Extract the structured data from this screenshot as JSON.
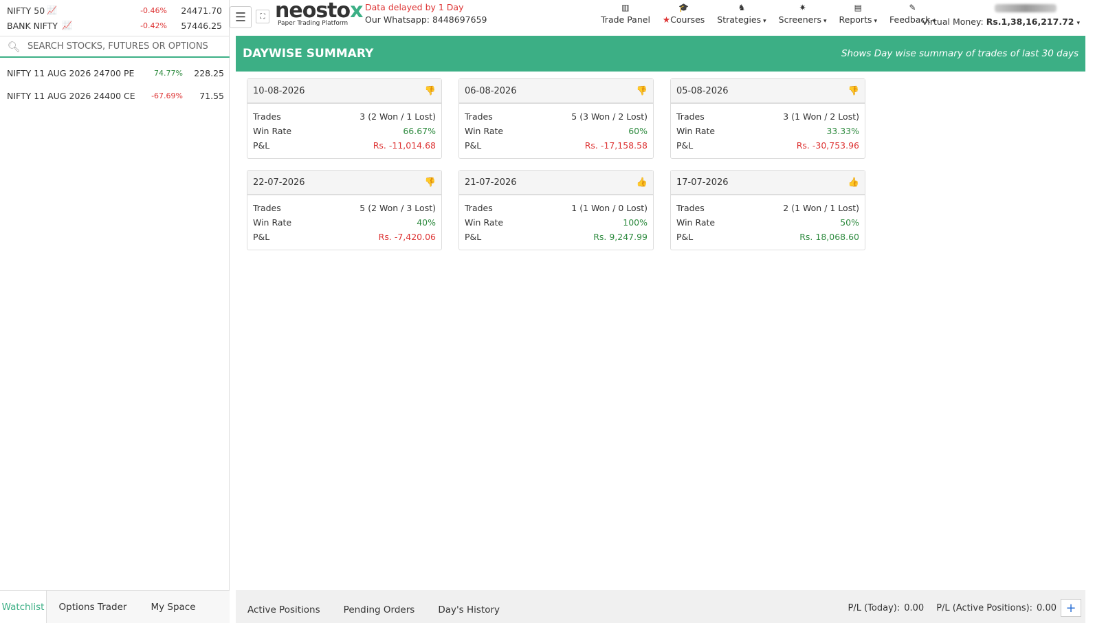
{
  "indices": [
    {
      "name": "NIFTY 50",
      "change": "-0.46%",
      "value": "24471.70"
    },
    {
      "name": "BANK NIFTY",
      "change": "-0.42%",
      "value": "57446.25"
    }
  ],
  "search": {
    "placeholder": "SEARCH STOCKS, FUTURES OR OPTIONS"
  },
  "watchlist": [
    {
      "name": "NIFTY 11 AUG 2026 24700 PE",
      "change": "74.77%",
      "value": "228.25"
    },
    {
      "name": "NIFTY 11 AUG 2026 24400 CE",
      "change": "-67.69%",
      "value": "71.55"
    }
  ],
  "side_tabs": [
    "Watchlist",
    "Options Trader",
    "My Space"
  ],
  "header": {
    "logo_main": "neosto",
    "logo_x": "x",
    "logo_sub": "Paper Trading Platform",
    "delay": "Data delayed by 1 Day",
    "whatsapp": "Our Whatsapp: 8448697659",
    "nav": [
      "Trade Panel",
      "Courses",
      "Strategies",
      "Screeners",
      "Reports",
      "Feedback"
    ],
    "money_label": "Virtual Money:",
    "money_value": "Rs.1,38,16,217.72"
  },
  "banner": {
    "title": "DAYWISE SUMMARY",
    "subtitle": "Shows Day wise summary of trades of last 30 days"
  },
  "labels": {
    "trades": "Trades",
    "win_rate": "Win Rate",
    "pnl": "P&L"
  },
  "cards": [
    {
      "date": "10-08-2026",
      "trades": "3 (2 Won / 1 Lost)",
      "win_rate": "66.67%",
      "pnl": "Rs. -11,014.68",
      "result": "down"
    },
    {
      "date": "06-08-2026",
      "trades": "5 (3 Won / 2 Lost)",
      "win_rate": "60%",
      "pnl": "Rs. -17,158.58",
      "result": "down"
    },
    {
      "date": "05-08-2026",
      "trades": "3 (1 Won / 2 Lost)",
      "win_rate": "33.33%",
      "pnl": "Rs. -30,753.96",
      "result": "down"
    },
    {
      "date": "22-07-2026",
      "trades": "5 (2 Won / 3 Lost)",
      "win_rate": "40%",
      "pnl": "Rs. -7,420.06",
      "result": "down"
    },
    {
      "date": "21-07-2026",
      "trades": "1 (1 Won / 0 Lost)",
      "win_rate": "100%",
      "pnl": "Rs. 9,247.99",
      "result": "up"
    },
    {
      "date": "17-07-2026",
      "trades": "2 (1 Won / 1 Lost)",
      "win_rate": "50%",
      "pnl": "Rs. 18,068.60",
      "result": "up"
    }
  ],
  "bottom": {
    "tabs": [
      "Active Positions",
      "Pending Orders",
      "Day's History"
    ],
    "pl_today_label": "P/L (Today):",
    "pl_today_value": "0.00",
    "pl_active_label": "P/L (Active Positions):",
    "pl_active_value": "0.00",
    "plus": "+"
  },
  "colors": {
    "accent": "#3caf85",
    "negative": "#dd3333",
    "positive": "#2d8a3e"
  }
}
